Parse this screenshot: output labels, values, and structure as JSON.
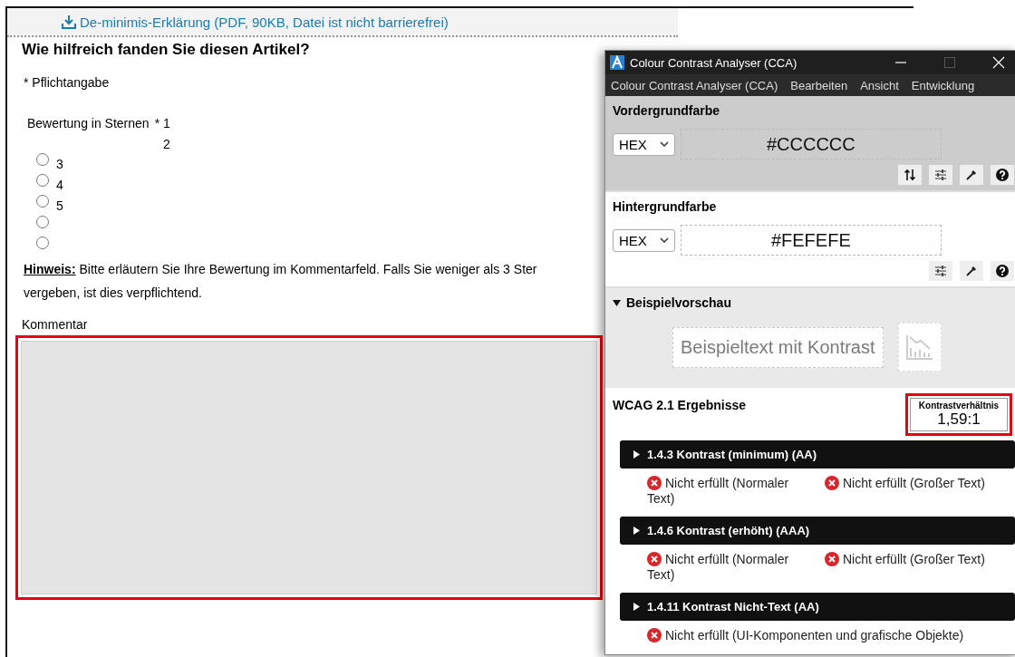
{
  "page": {
    "download_link": "De-minimis-Erklärung (PDF, 90KB, Datei ist nicht barrierefrei)",
    "heading": "Wie hilfreich fanden Sie diesen Artikel?",
    "required_note": "* Pflichtangabe",
    "rating": {
      "label": "Bewertung in Sternen",
      "required_mark": "*",
      "labels": [
        "1",
        "2",
        "3",
        "4",
        "5"
      ],
      "radios": [
        {
          "selected": false
        },
        {
          "selected": false
        },
        {
          "selected": false
        },
        {
          "selected": false
        },
        {
          "selected": false
        }
      ]
    },
    "hint": [
      "**Hinweis:** Bitte erläutern Sie Ihre Bewertung im Kommentarfeld. Falls Sie weniger als 3 Ster",
      "vergeben, ist dies verpflichtend."
    ],
    "comment": {
      "label": "Kommentar",
      "highlighted": true
    }
  },
  "cca_window": {
    "title": "Colour Contrast Analyser (CCA)",
    "menu": [
      "Colour Contrast Analyser (CCA)",
      "Bearbeiten",
      "Ansicht",
      "Entwicklung"
    ],
    "foreground": {
      "heading": "Vordergrundfarbe",
      "format": "HEX",
      "value": "#CCCCCC"
    },
    "background": {
      "heading": "Hintergrundfarbe",
      "format": "HEX",
      "value": "#FEFEFE"
    },
    "preview": {
      "heading": "Beispielvorschau",
      "expanded": true,
      "sample_text": "Beispieltext mit Kontrast"
    },
    "results": {
      "heading": "WCAG 2.1 Ergebnisse",
      "ratio_label": "Kontrastverhältnis",
      "ratio": "1,59:1",
      "ratio_highlighted": true,
      "criteria": [
        {
          "title": "1.4.3 Kontrast (minimum) (AA)",
          "expanded": false,
          "checks": [
            {
              "text": "Nicht erfüllt (Normaler Text)",
              "passed": false
            },
            {
              "text": "Nicht erfüllt (Großer Text)",
              "passed": false
            }
          ]
        },
        {
          "title": "1.4.6 Kontrast (erhöht) (AAA)",
          "expanded": false,
          "checks": [
            {
              "text": "Nicht erfüllt (Normaler Text)",
              "passed": false
            },
            {
              "text": "Nicht erfüllt (Großer Text)",
              "passed": false
            }
          ]
        },
        {
          "title": "1.4.11 Kontrast Nicht-Text (AA)",
          "expanded": false,
          "checks": [
            {
              "text": "Nicht erfüllt (UI-Komponenten und grafische Objekte)",
              "passed": false
            }
          ]
        }
      ]
    }
  }
}
